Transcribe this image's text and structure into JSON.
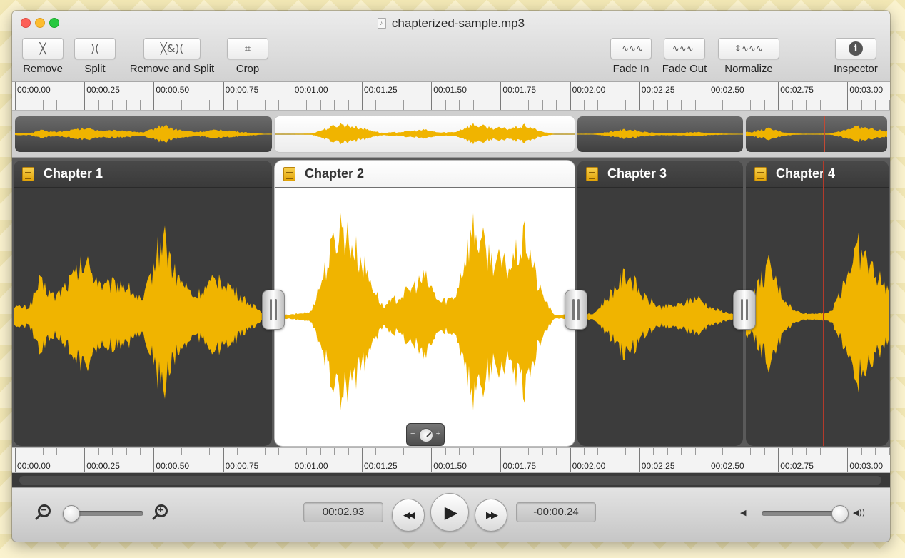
{
  "window": {
    "title": "chapterized-sample.mp3"
  },
  "toolbar": {
    "left": [
      {
        "id": "remove",
        "label": "Remove",
        "glyph": "╳",
        "icon": "scissors-icon"
      },
      {
        "id": "split",
        "label": "Split",
        "glyph": ")(",
        "icon": "split-icon"
      },
      {
        "id": "remove-and-split",
        "label": "Remove and Split",
        "glyph": "╳&)(",
        "icon": "remove-and-split-icon"
      },
      {
        "id": "crop",
        "label": "Crop",
        "glyph": "⌗",
        "icon": "crop-icon"
      }
    ],
    "right": [
      {
        "id": "fade-in",
        "label": "Fade In",
        "glyph": "-∿∿∿",
        "icon": "fade-in-icon"
      },
      {
        "id": "fade-out",
        "label": "Fade Out",
        "glyph": "∿∿∿-",
        "icon": "fade-out-icon"
      },
      {
        "id": "normalize",
        "label": "Normalize",
        "glyph": "↕∿∿∿",
        "icon": "normalize-icon"
      },
      {
        "id": "inspector",
        "label": "Inspector",
        "glyph": "i",
        "icon": "info-icon"
      }
    ]
  },
  "ruler": {
    "labels": [
      "00:00.00",
      "00:00.25",
      "00:00.50",
      "00:00.75",
      "00:01.00",
      "00:01.25",
      "00:01.50",
      "00:01.75",
      "00:02.00",
      "00:02.25",
      "00:02.50",
      "00:02.75",
      "00:03.00"
    ]
  },
  "chapters": [
    {
      "title": "Chapter 1",
      "selected": false
    },
    {
      "title": "Chapter 2",
      "selected": true
    },
    {
      "title": "Chapter 3",
      "selected": false
    },
    {
      "title": "Chapter 4",
      "selected": false
    }
  ],
  "transport": {
    "elapsed": "00:02.93",
    "remaining": "-00:00.24",
    "rewind_glyph": "◀◀",
    "play_glyph": "▶",
    "forward_glyph": "▶▶",
    "zoom_out_glyph": "−",
    "zoom_in_glyph": "+",
    "volume_low_glyph": "◀",
    "volume_high_glyph": "◀))",
    "zoom_level": 0.0,
    "volume_level": 1.0
  },
  "colors": {
    "waveform": "#f0b400",
    "playhead": "#b33a2b",
    "chapter_dark": "#3c3c3c",
    "chapter_selected": "#ffffff"
  },
  "playhead_time": "00:02.93"
}
